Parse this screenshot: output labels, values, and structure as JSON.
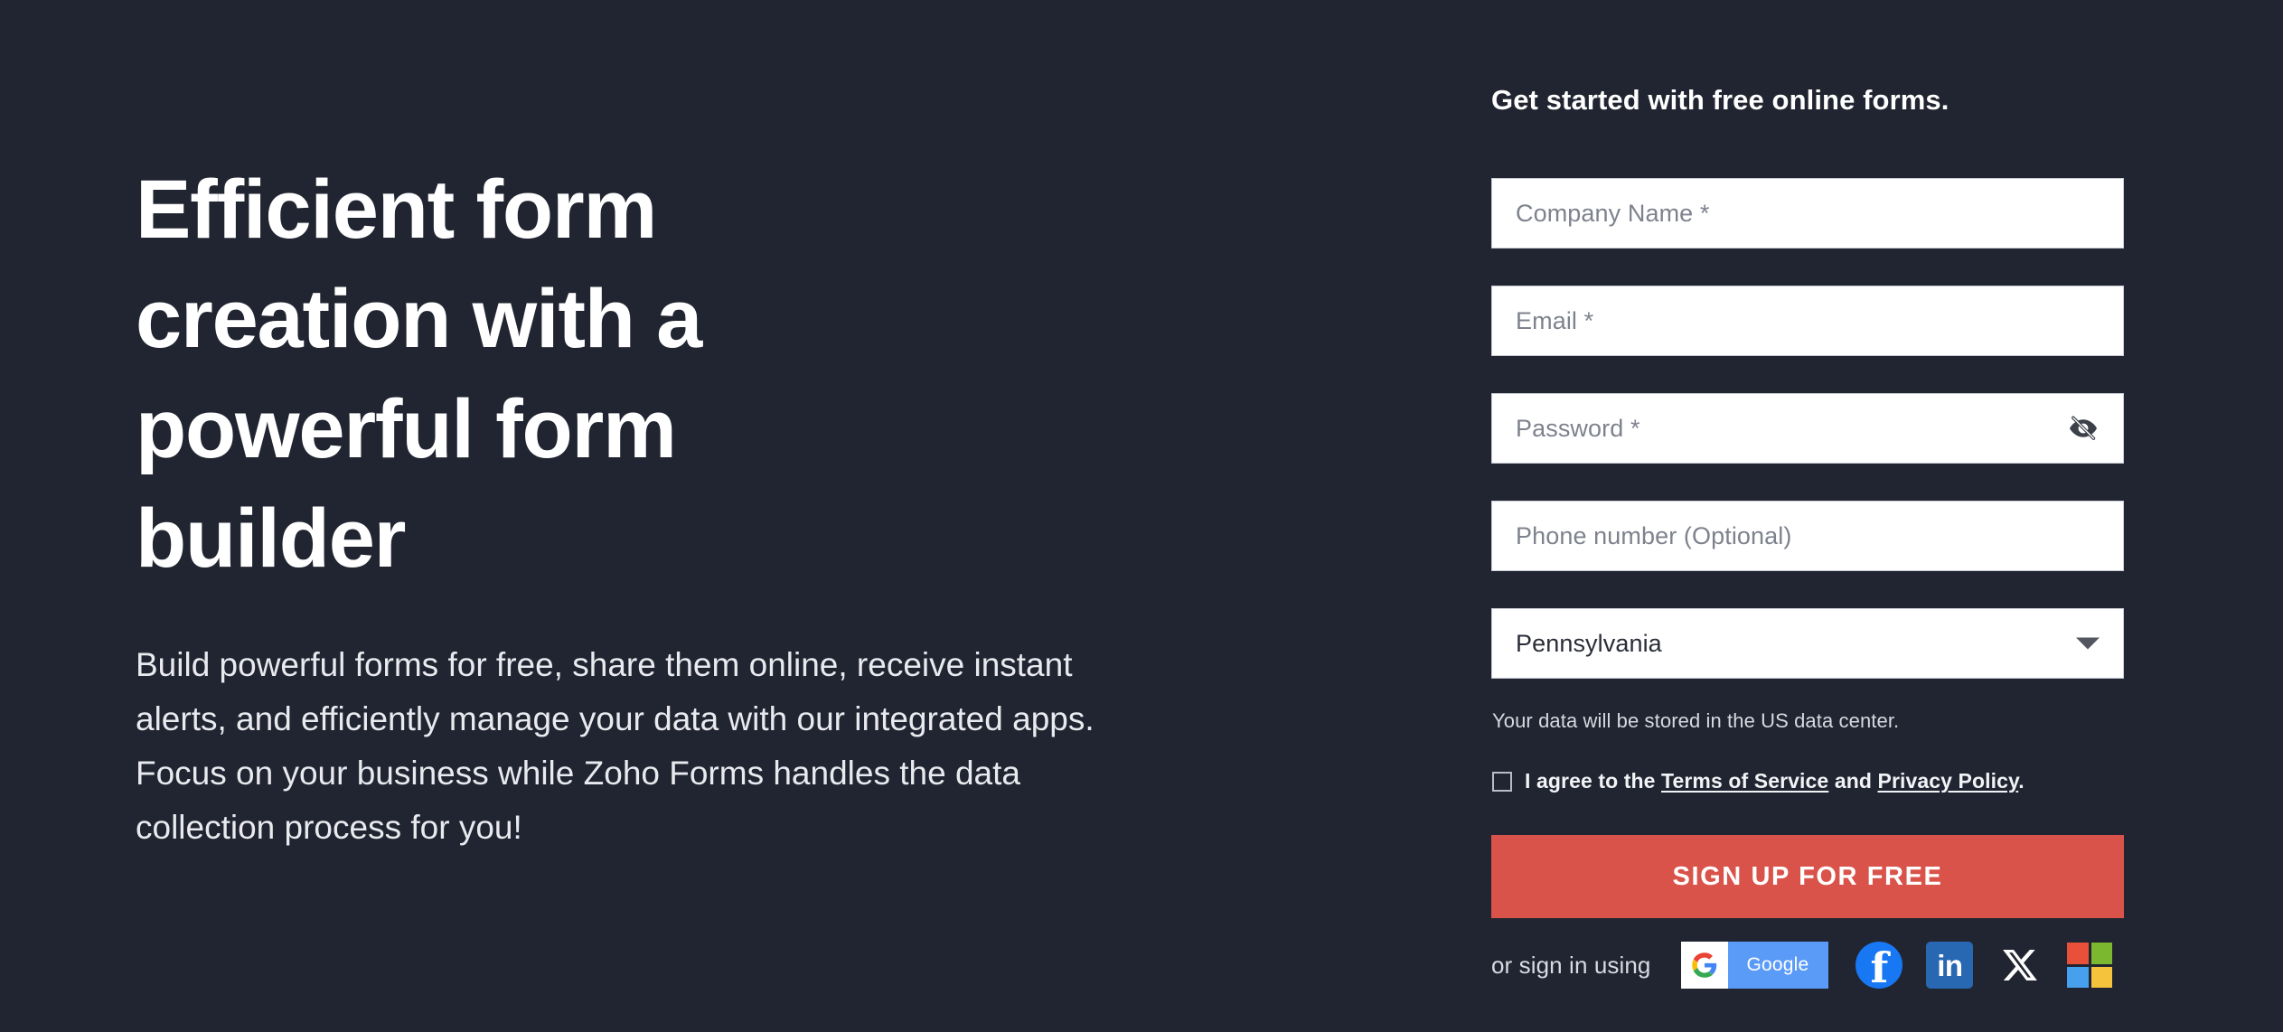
{
  "hero": {
    "title": "Efficient form creation with a powerful form builder",
    "description": "Build powerful forms for free, share them online, receive instant alerts, and efficiently manage your data with our integrated apps. Focus on your business while Zoho Forms handles the data collection process for you!"
  },
  "signup": {
    "heading": "Get started with free online forms.",
    "fields": [
      {
        "name": "company",
        "placeholder": "Company Name *",
        "value": ""
      },
      {
        "name": "email",
        "placeholder": "Email *",
        "value": ""
      },
      {
        "name": "password",
        "placeholder": "Password *",
        "value": "",
        "icon": "eye-off-icon"
      },
      {
        "name": "phone",
        "placeholder": "Phone number (Optional)",
        "value": ""
      }
    ],
    "region_select": {
      "selected": "Pennsylvania",
      "icon": "chevron-down-icon"
    },
    "datacenter_note": "Your data will be stored in the US data center.",
    "consent": {
      "checked": false,
      "prefix": "I agree to the",
      "terms_label": "Terms of Service",
      "conjunction": "and",
      "privacy_label": "Privacy Policy",
      "suffix": "."
    },
    "cta_label": "SIGN UP FOR FREE",
    "social": {
      "label": "or sign in using",
      "providers": [
        {
          "name": "google",
          "label": "Google",
          "icon": "google-icon"
        },
        {
          "name": "facebook",
          "label": "f",
          "icon": "facebook-icon"
        },
        {
          "name": "linkedin",
          "label": "in",
          "icon": "linkedin-icon"
        },
        {
          "name": "x",
          "label": "X",
          "icon": "x-twitter-icon"
        },
        {
          "name": "microsoft",
          "label": "",
          "icon": "microsoft-icon"
        }
      ]
    }
  },
  "colors": {
    "background": "#212531",
    "accent_red": "#d9534a",
    "field_white": "#ffffff",
    "google_blue": "#5b9bf8",
    "facebook_blue": "#1877f2",
    "linkedin_blue": "#2867b2",
    "ms_red": "#e8503a",
    "ms_green": "#7cb82f",
    "ms_blue": "#47a0ee",
    "ms_yellow": "#f6c33c"
  }
}
